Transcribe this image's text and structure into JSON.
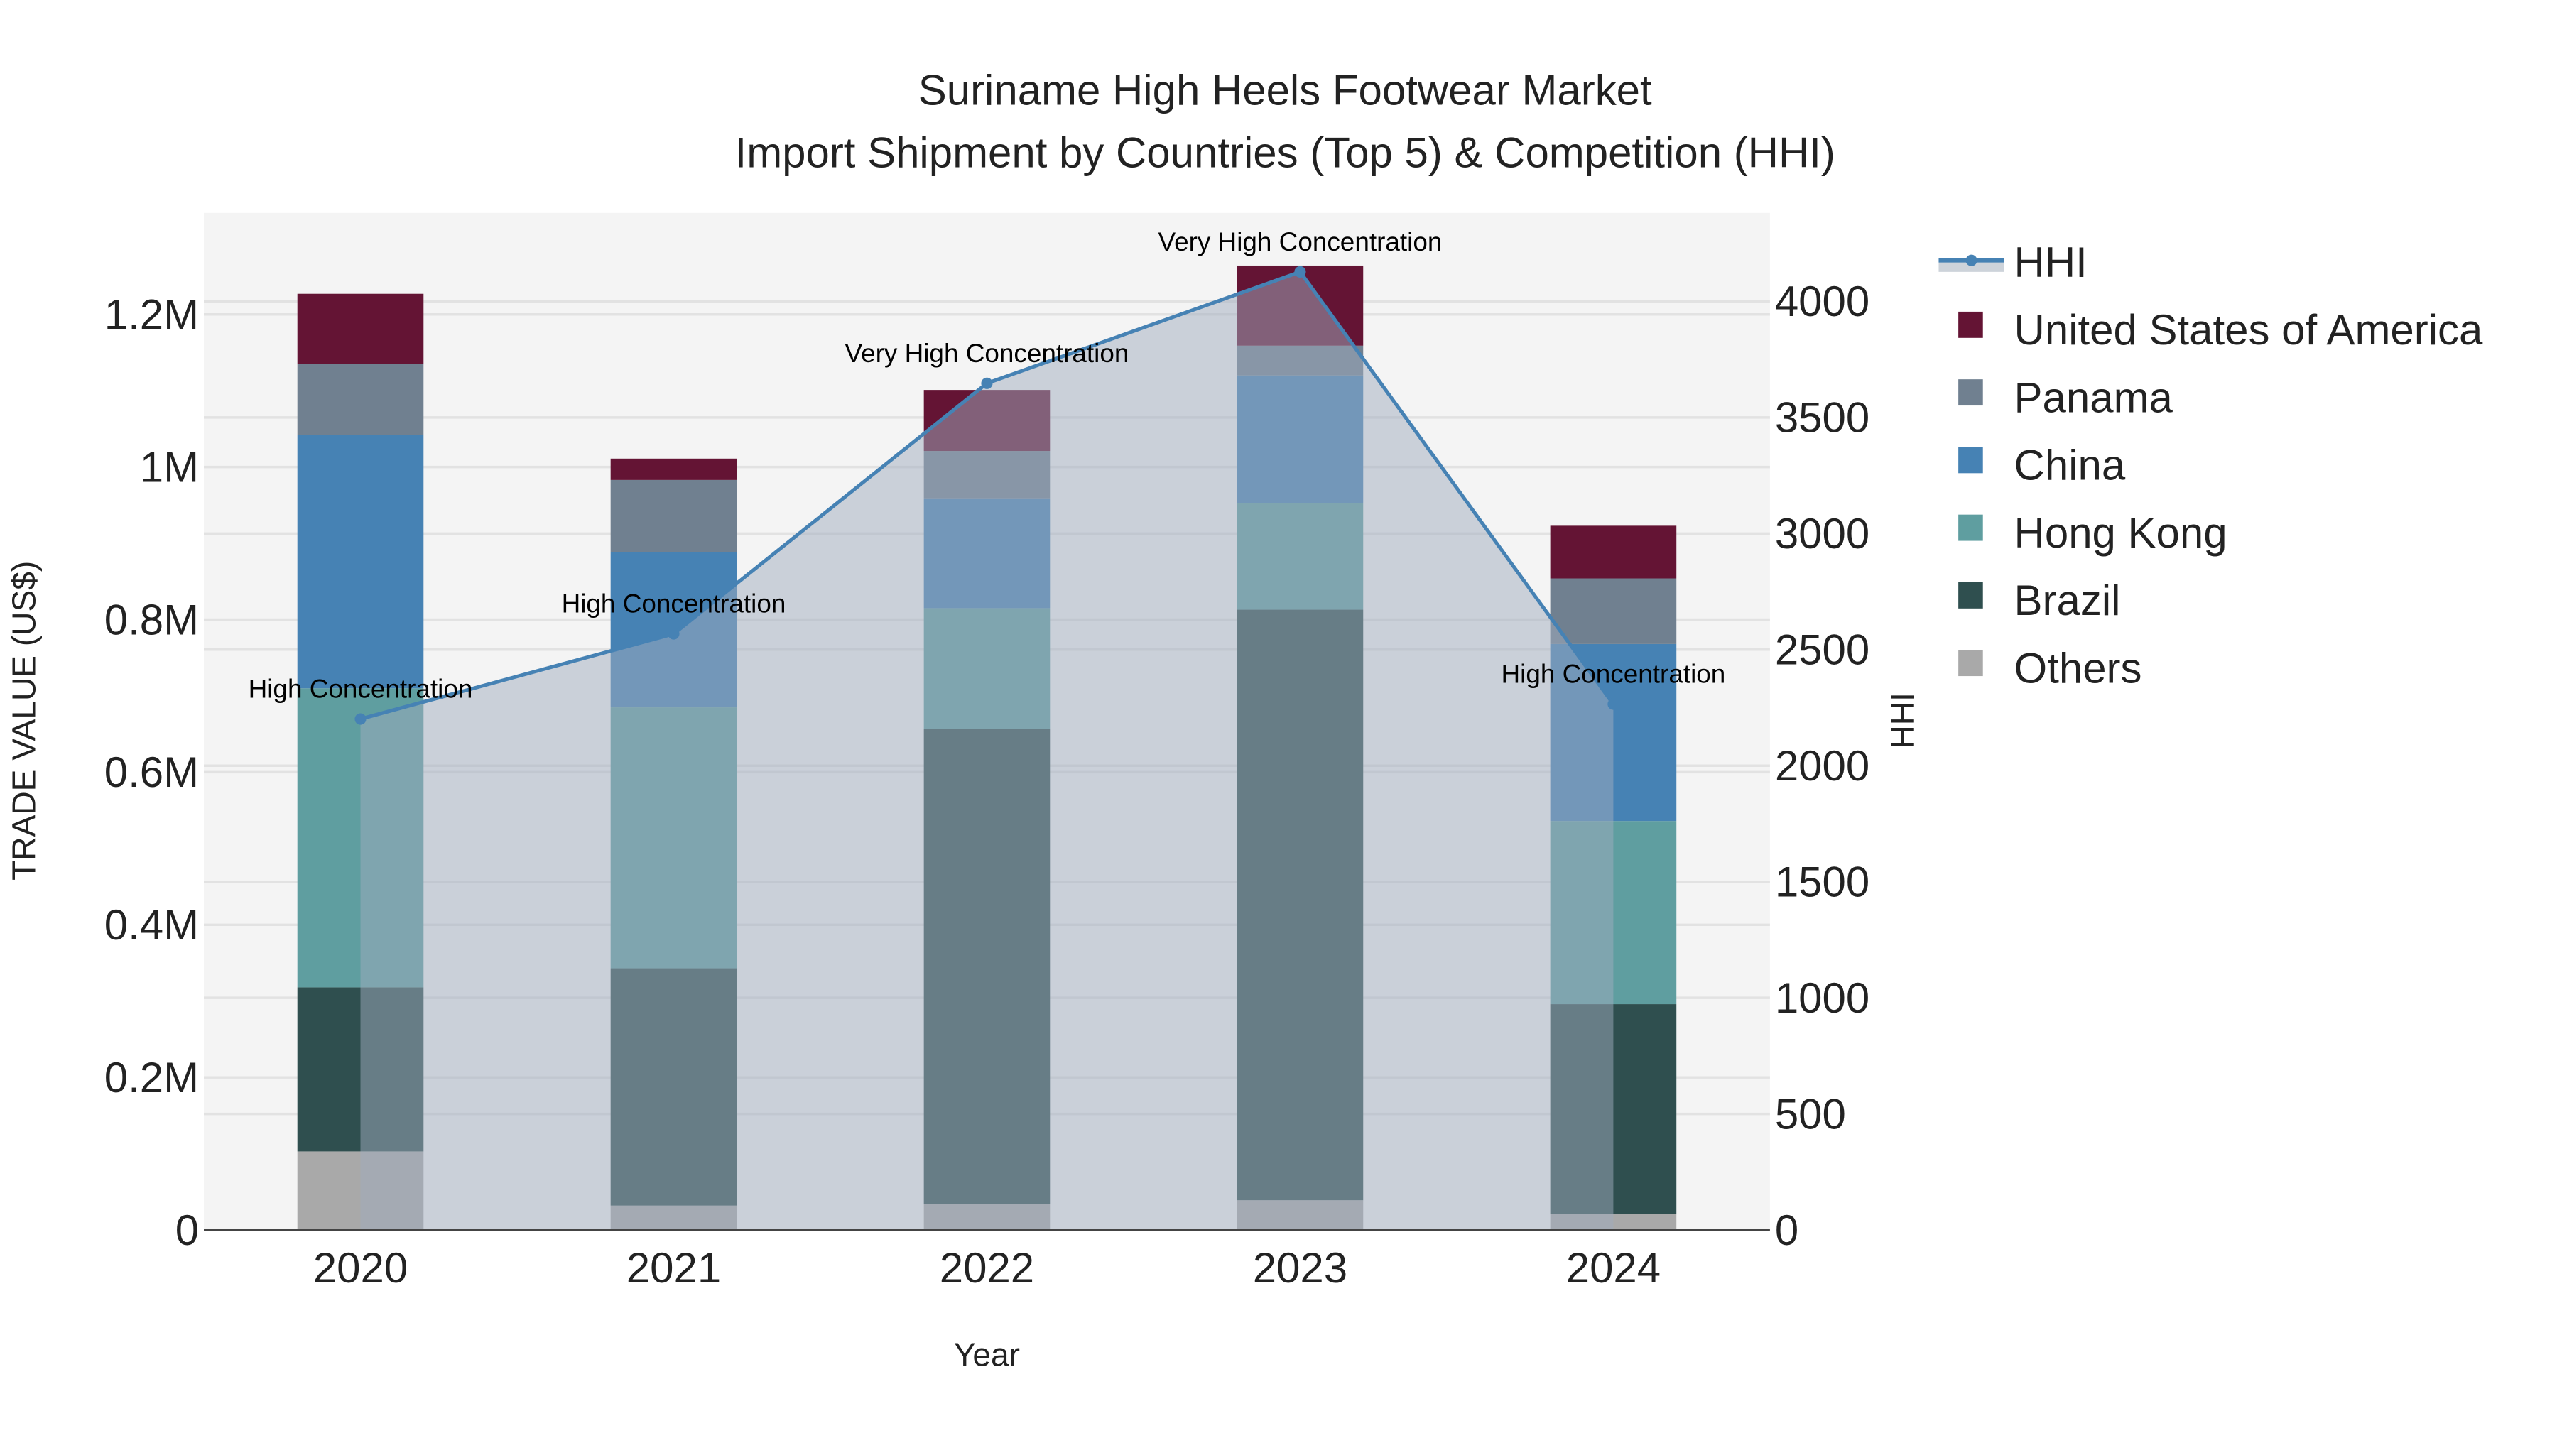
{
  "chart_data": {
    "type": "bar",
    "title": "Suriname High Heels Footwear Market",
    "subtitle": "Import Shipment by Countries (Top 5) & Competition (HHI)",
    "xlabel": "Year",
    "ylabel": "TRADE VALUE (US$)",
    "y2label": "HHI",
    "categories": [
      "2020",
      "2021",
      "2022",
      "2023",
      "2024"
    ],
    "ylim": [
      0,
      1333000
    ],
    "y2lim": [
      0,
      4381
    ],
    "yticks": [
      {
        "v": 0,
        "label": "0"
      },
      {
        "v": 200000,
        "label": "0.2M"
      },
      {
        "v": 400000,
        "label": "0.4M"
      },
      {
        "v": 600000,
        "label": "0.6M"
      },
      {
        "v": 800000,
        "label": "0.8M"
      },
      {
        "v": 1000000,
        "label": "1M"
      },
      {
        "v": 1200000,
        "label": "1.2M"
      }
    ],
    "y2ticks": [
      {
        "v": 0,
        "label": "0"
      },
      {
        "v": 500,
        "label": "500"
      },
      {
        "v": 1000,
        "label": "1000"
      },
      {
        "v": 1500,
        "label": "1500"
      },
      {
        "v": 2000,
        "label": "2000"
      },
      {
        "v": 2500,
        "label": "2500"
      },
      {
        "v": 3000,
        "label": "3000"
      },
      {
        "v": 3500,
        "label": "3500"
      },
      {
        "v": 4000,
        "label": "4000"
      }
    ],
    "stack_order": [
      "Others",
      "Brazil",
      "Hong Kong",
      "China",
      "Panama",
      "United States of America"
    ],
    "series": [
      {
        "name": "Others",
        "color": "#a9a9a9",
        "values": [
          103000,
          32000,
          34000,
          39000,
          21000
        ]
      },
      {
        "name": "Brazil",
        "color": "#2f4f4f",
        "values": [
          215000,
          311000,
          623000,
          774000,
          275000
        ]
      },
      {
        "name": "Hong Kong",
        "color": "#5f9ea0",
        "values": [
          392000,
          342000,
          158000,
          140000,
          240000
        ]
      },
      {
        "name": "China",
        "color": "#4682b4",
        "values": [
          332000,
          203000,
          144000,
          167000,
          232000
        ]
      },
      {
        "name": "Panama",
        "color": "#708090",
        "values": [
          93000,
          95000,
          62000,
          39000,
          86000
        ]
      },
      {
        "name": "United States of America",
        "color": "#641434",
        "values": [
          92000,
          28000,
          80000,
          105000,
          69000
        ]
      }
    ],
    "line": {
      "name": "HHI",
      "color": "#4682b4",
      "fill": "tozeroy",
      "values": [
        2201,
        2568,
        3647,
        4127,
        2265
      ],
      "annotations": [
        "High Concentration",
        "High Concentration",
        "Very High Concentration",
        "Very High Concentration",
        "High Concentration"
      ]
    },
    "legend": {
      "placement": "right",
      "entries": [
        "HHI",
        "United States of America",
        "Panama",
        "China",
        "Hong Kong",
        "Brazil",
        "Others"
      ]
    },
    "grid": true
  }
}
